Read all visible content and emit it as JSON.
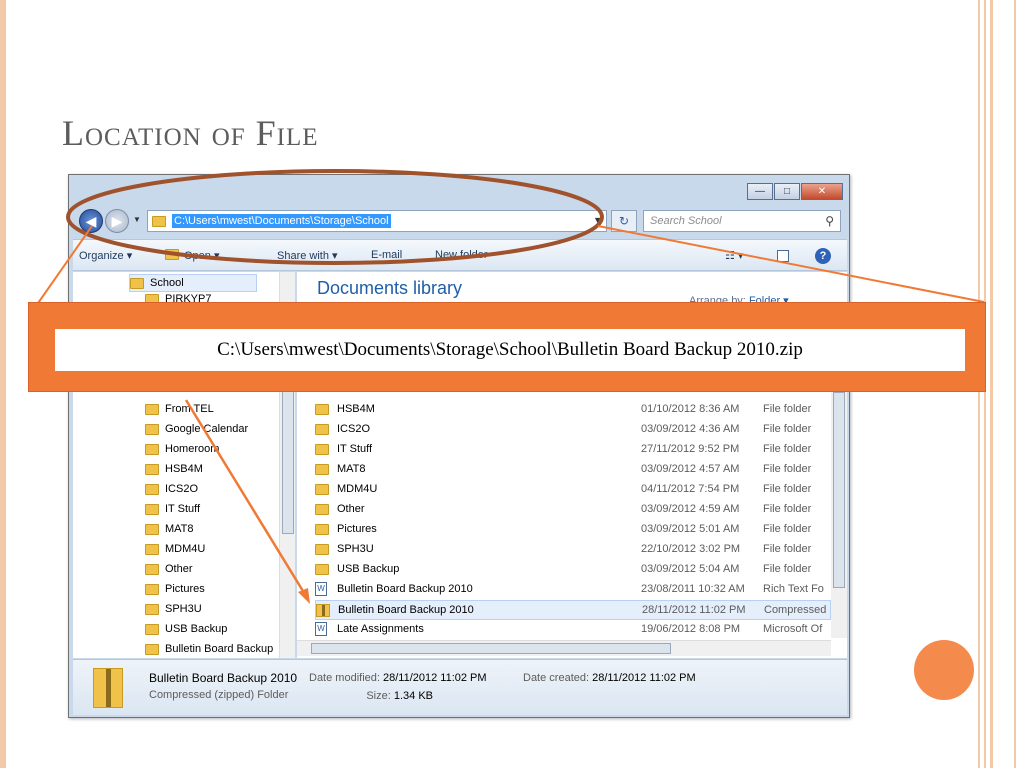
{
  "slide": {
    "title": "Location of File",
    "accent_color": "#f07a35"
  },
  "window": {
    "caption_buttons": {
      "minimize": "—",
      "maximize": "□",
      "close": "✕"
    },
    "address": "C:\\Users\\mwest\\Documents\\Storage\\School",
    "search_placeholder": "Search School",
    "toolbar": {
      "organize": "Organize ▾",
      "open": "Open ▾",
      "share": "Share with ▾",
      "email": "E-mail",
      "new_folder": "New folder"
    },
    "nav_tree": [
      {
        "label": "School",
        "selected": true
      },
      {
        "label": "PIRKYP7"
      },
      {
        "label": "From TEL"
      },
      {
        "label": "Google Calendar"
      },
      {
        "label": "Homeroom"
      },
      {
        "label": "HSB4M"
      },
      {
        "label": "ICS2O"
      },
      {
        "label": "IT Stuff"
      },
      {
        "label": "MAT8"
      },
      {
        "label": "MDM4U"
      },
      {
        "label": "Other"
      },
      {
        "label": "Pictures"
      },
      {
        "label": "SPH3U"
      },
      {
        "label": "USB Backup"
      },
      {
        "label": "Bulletin Board Backup"
      }
    ],
    "library_title": "Documents library",
    "arrange_label": "Arrange by:",
    "arrange_value": "Folder ▾",
    "files": [
      {
        "name": "HSB4M",
        "date": "01/10/2012 8:36 AM",
        "type": "File folder",
        "icon": "folder"
      },
      {
        "name": "ICS2O",
        "date": "03/09/2012 4:36 AM",
        "type": "File folder",
        "icon": "folder"
      },
      {
        "name": "IT Stuff",
        "date": "27/11/2012 9:52 PM",
        "type": "File folder",
        "icon": "folder"
      },
      {
        "name": "MAT8",
        "date": "03/09/2012 4:57 AM",
        "type": "File folder",
        "icon": "folder"
      },
      {
        "name": "MDM4U",
        "date": "04/11/2012 7:54 PM",
        "type": "File folder",
        "icon": "folder"
      },
      {
        "name": "Other",
        "date": "03/09/2012 4:59 AM",
        "type": "File folder",
        "icon": "folder"
      },
      {
        "name": "Pictures",
        "date": "03/09/2012 5:01 AM",
        "type": "File folder",
        "icon": "folder"
      },
      {
        "name": "SPH3U",
        "date": "22/10/2012 3:02 PM",
        "type": "File folder",
        "icon": "folder"
      },
      {
        "name": "USB Backup",
        "date": "03/09/2012 5:04 AM",
        "type": "File folder",
        "icon": "folder"
      },
      {
        "name": "Bulletin Board Backup 2010",
        "date": "23/08/2011 10:32 AM",
        "type": "Rich Text Fo",
        "icon": "document"
      },
      {
        "name": "Bulletin Board Backup 2010",
        "date": "28/11/2012 11:02 PM",
        "type": "Compressed",
        "icon": "zip",
        "selected": true
      },
      {
        "name": "Late Assignments",
        "date": "19/06/2012 8:08 PM",
        "type": "Microsoft Of",
        "icon": "document"
      }
    ],
    "details": {
      "name": "Bulletin Board Backup 2010",
      "kind": "Compressed (zipped) Folder",
      "modified_label": "Date modified:",
      "modified": "28/11/2012 11:02 PM",
      "created_label": "Date created:",
      "created": "28/11/2012 11:02 PM",
      "size_label": "Size:",
      "size": "1.34 KB"
    }
  },
  "callout": {
    "text": "C:\\Users\\mwest\\Documents\\Storage\\School\\Bulletin Board Backup 2010.zip"
  }
}
